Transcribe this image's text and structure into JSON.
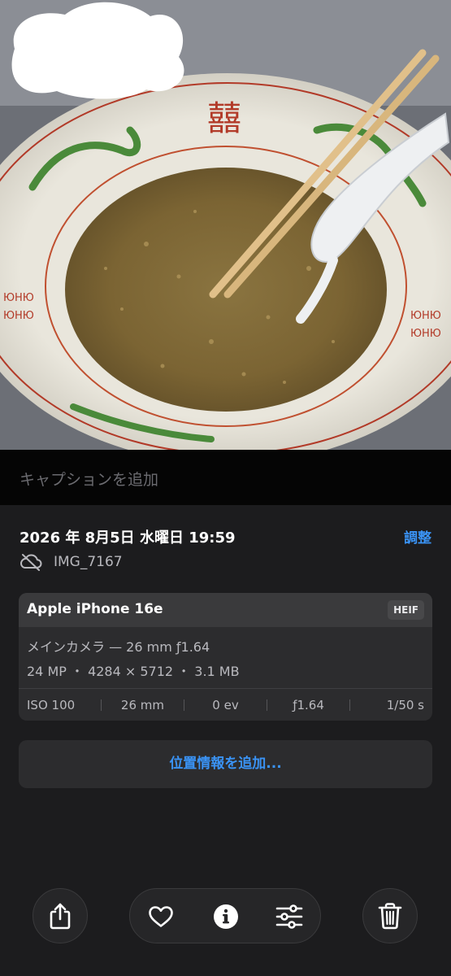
{
  "photo": {
    "subject": "noodle-soup-bowl-with-chopsticks-and-spoon",
    "bowl_text": "囍"
  },
  "caption": {
    "placeholder": "キャプションを追加"
  },
  "info": {
    "datetime": "2026 年 8月5日 水曜日 19:59",
    "adjust_label": "調整",
    "filename": "IMG_7167",
    "file_icon": "cloud-slash-icon"
  },
  "camera_card": {
    "device": "Apple iPhone 16e",
    "format": "HEIF",
    "lens": "メインカメラ — 26 mm ƒ1.64",
    "specs": "24 MP ・ 4284 × 5712 ・ 3.1 MB",
    "exif": {
      "iso": "ISO 100",
      "focal_length": "26 mm",
      "exposure_bias": "0 ev",
      "aperture": "ƒ1.64",
      "shutter": "1/50 s"
    }
  },
  "location": {
    "add_label": "位置情報を追加..."
  },
  "toolbar": {
    "icons": [
      "share-icon",
      "heart-icon",
      "info-icon",
      "sliders-icon",
      "trash-icon"
    ]
  },
  "colors": {
    "accent": "#3a93f5",
    "panel_bg": "#1c1c1e",
    "card_bg": "#2c2c2e"
  }
}
